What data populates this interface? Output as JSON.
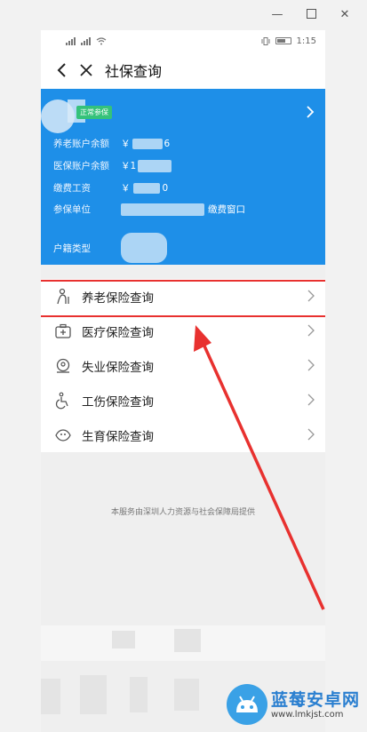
{
  "window": {
    "minimize_label": "—",
    "close_label": "✕"
  },
  "status_bar": {
    "time": "1:15"
  },
  "nav": {
    "title": "社保查询"
  },
  "card": {
    "badge": "正常参保",
    "rows": [
      {
        "label": "养老账户余额",
        "value_prefix": "￥",
        "value_suffix": "6"
      },
      {
        "label": "医保账户余额",
        "value_prefix": "￥1",
        "value_suffix": ""
      },
      {
        "label": "缴费工资",
        "value_prefix": "￥",
        "value_suffix": "0"
      },
      {
        "label": "参保单位",
        "value_prefix": "",
        "value_suffix": "缴费窗口"
      },
      {
        "label": "户籍类型",
        "value_prefix": "",
        "value_suffix": ""
      }
    ]
  },
  "menu": {
    "items": [
      {
        "label": "养老保险查询",
        "icon": "elderly-icon"
      },
      {
        "label": "医疗保险查询",
        "icon": "medical-kit-icon"
      },
      {
        "label": "失业保险查询",
        "icon": "unemployment-icon"
      },
      {
        "label": "工伤保险查询",
        "icon": "wheelchair-icon"
      },
      {
        "label": "生育保险查询",
        "icon": "maternity-icon"
      }
    ]
  },
  "footer": {
    "note": "本服务由深圳人力资源与社会保障局提供"
  },
  "watermark": {
    "title": "蓝莓安卓网",
    "url": "www.lmkjst.com"
  },
  "colors": {
    "card_blue": "#1e8fe8",
    "highlight_red": "#e8312f",
    "badge_green": "#35c27a"
  }
}
